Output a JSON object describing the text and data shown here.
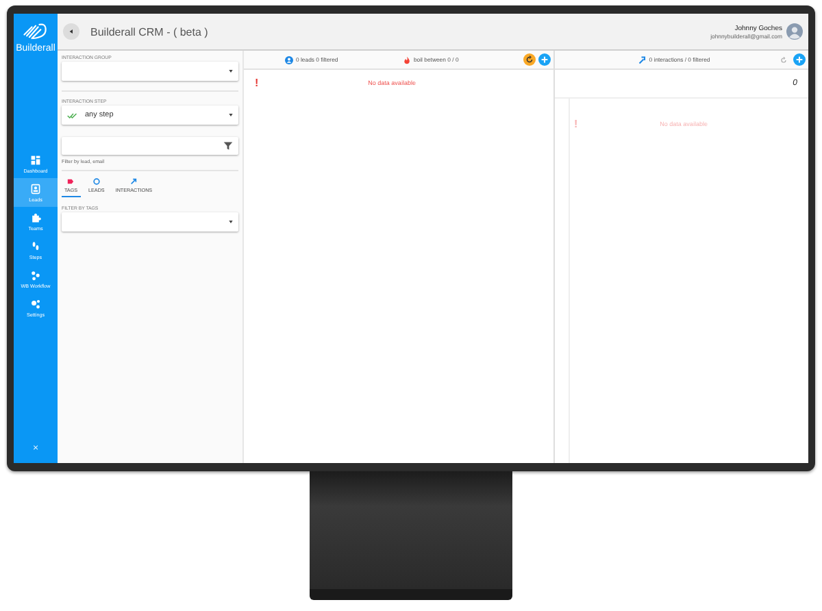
{
  "sidebar": {
    "logo_text": "Builderall",
    "items": [
      {
        "label": "Dashboard",
        "selected": false
      },
      {
        "label": "Leads",
        "selected": true
      },
      {
        "label": "Teams",
        "selected": false
      },
      {
        "label": "Steps",
        "selected": false
      },
      {
        "label": "WB Workflow",
        "selected": false
      },
      {
        "label": "Settings",
        "selected": false
      }
    ],
    "collapse": "×"
  },
  "header": {
    "title": "Builderall CRM - ( beta )",
    "user_name": "Johnny Goches",
    "user_email": "johnnybuilderall@gmail.com"
  },
  "filters": {
    "group_label": "INTERACTION GROUP",
    "step_label": "INTERACTION STEP",
    "step_value": "any step",
    "search_hint": "Filter by lead, email",
    "tabs": [
      {
        "label": "TAGS",
        "selected": true
      },
      {
        "label": "LEADS",
        "selected": false
      },
      {
        "label": "INTERACTIONS",
        "selected": false
      }
    ],
    "tags_label": "FILTER BY TAGS"
  },
  "leads_panel": {
    "count": "0 leads 0 filtered",
    "boil": "boil between 0 / 0",
    "alert": "!",
    "empty": "No data available"
  },
  "interactions_panel": {
    "count": "0 interactions / 0 filtered",
    "total": "0",
    "alert": "!",
    "empty": "No data available"
  }
}
